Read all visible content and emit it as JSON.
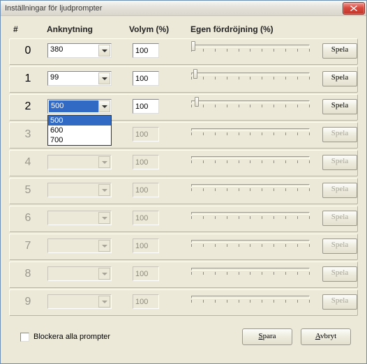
{
  "title": "Inställningar för ljudprompter",
  "headers": {
    "index": "#",
    "extension": "Anknytning",
    "volume": "Volym (%)",
    "delay": "Egen fördröjning (%)"
  },
  "play_label": "Spela",
  "rows": [
    {
      "index": "0",
      "ext": "380",
      "volume": "100",
      "delay_pct": 0,
      "enabled": true,
      "open": false
    },
    {
      "index": "1",
      "ext": "99",
      "volume": "100",
      "delay_pct": 2,
      "enabled": true,
      "open": false
    },
    {
      "index": "2",
      "ext": "500",
      "volume": "100",
      "delay_pct": 3,
      "enabled": true,
      "open": true,
      "options": [
        "500",
        "600",
        "700"
      ]
    },
    {
      "index": "3",
      "ext": "",
      "volume": "100",
      "delay_pct": 0,
      "enabled": false,
      "open": false
    },
    {
      "index": "4",
      "ext": "",
      "volume": "100",
      "delay_pct": 0,
      "enabled": false,
      "open": false
    },
    {
      "index": "5",
      "ext": "",
      "volume": "100",
      "delay_pct": 0,
      "enabled": false,
      "open": false
    },
    {
      "index": "6",
      "ext": "",
      "volume": "100",
      "delay_pct": 0,
      "enabled": false,
      "open": false
    },
    {
      "index": "7",
      "ext": "",
      "volume": "100",
      "delay_pct": 0,
      "enabled": false,
      "open": false
    },
    {
      "index": "8",
      "ext": "",
      "volume": "100",
      "delay_pct": 0,
      "enabled": false,
      "open": false
    },
    {
      "index": "9",
      "ext": "",
      "volume": "100",
      "delay_pct": 0,
      "enabled": false,
      "open": false
    }
  ],
  "footer": {
    "block_label": "Blockera alla prompter",
    "save": {
      "accel": "S",
      "rest": "para"
    },
    "cancel": {
      "accel": "A",
      "rest": "vbryt"
    }
  }
}
